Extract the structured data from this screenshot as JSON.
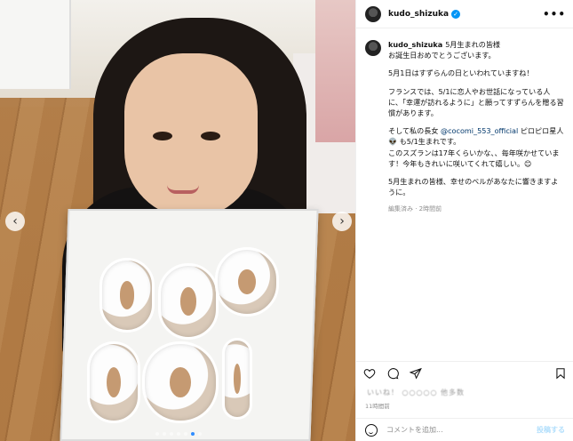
{
  "post": {
    "username": "kudo_shizuka",
    "more_label": "•••",
    "caption_lines": [
      "5月生まれの皆様\nお誕生日おめでとうございます。",
      "5月1日はすずらんの日といわれていますね！",
      "フランスでは、5/1に恋人やお世話になっている人に、「幸運が訪れるように」と願ってすずらんを贈る習慣があります。",
      "そして私の長女",
      "@cocomi_553_official",
      "ピロピロ星人 👽 も5/1生まれです。\nこのスズランは17年くらいかな、、毎年咲かせています！今年もきれいに咲いてくれて嬉しい。😊",
      "5月生まれの皆様、幸せのベルがあなたに響きますように。"
    ],
    "caption_meta": "編集済み · 2時間前",
    "likes_text": "いいね！ ○○○○○ 他多数",
    "time_ago": "11時間前"
  },
  "comment": {
    "placeholder": "コメントを追加...",
    "post_label": "投稿する"
  },
  "carousel": {
    "prev": "‹",
    "next": "›"
  },
  "colors": {
    "accent": "#0095f6",
    "link": "#00376b",
    "muted": "#8e8e8e"
  },
  "icons": [
    "heart-icon",
    "comment-icon",
    "share-icon",
    "bookmark-icon",
    "emoji-icon",
    "verified-icon",
    "more-icon"
  ]
}
